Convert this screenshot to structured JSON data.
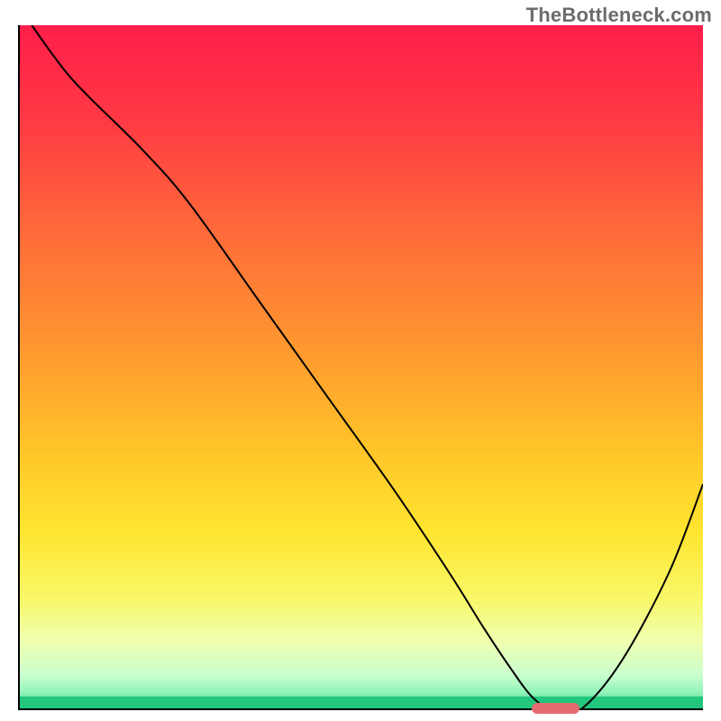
{
  "watermark": "TheBottleneck.com",
  "chart_data": {
    "type": "line",
    "title": "",
    "xlabel": "",
    "ylabel": "",
    "xlim": [
      0,
      100
    ],
    "ylim": [
      0,
      100
    ],
    "grid": false,
    "legend_position": "none",
    "background_gradient_stops": [
      {
        "offset": 0.0,
        "color": "#ff1e4a"
      },
      {
        "offset": 0.14,
        "color": "#ff3a44"
      },
      {
        "offset": 0.3,
        "color": "#ff6a3a"
      },
      {
        "offset": 0.48,
        "color": "#ff9a2f"
      },
      {
        "offset": 0.62,
        "color": "#ffc528"
      },
      {
        "offset": 0.74,
        "color": "#ffe530"
      },
      {
        "offset": 0.84,
        "color": "#f8f86a"
      },
      {
        "offset": 0.9,
        "color": "#efffb0"
      },
      {
        "offset": 0.95,
        "color": "#c8ffcf"
      },
      {
        "offset": 0.975,
        "color": "#8ef2b8"
      },
      {
        "offset": 1.0,
        "color": "#22c77d"
      }
    ],
    "green_band": {
      "y_from": 0.0,
      "y_to": 2.0,
      "color": "#22c77d"
    },
    "series": [
      {
        "name": "bottleneck-curve",
        "color": "#000000",
        "linewidth": 2,
        "x": [
          2,
          8,
          18,
          25,
          35,
          45,
          55,
          63,
          68,
          72,
          75,
          78,
          82,
          88,
          95,
          100
        ],
        "y": [
          100,
          92,
          82,
          74,
          60,
          46,
          32,
          20,
          12,
          6,
          2,
          0,
          0,
          7,
          20,
          33
        ]
      }
    ],
    "marker": {
      "name": "optimal-range-marker",
      "color": "#e46a6f",
      "shape": "pill",
      "x_from": 75,
      "x_to": 82,
      "y": 0
    }
  }
}
